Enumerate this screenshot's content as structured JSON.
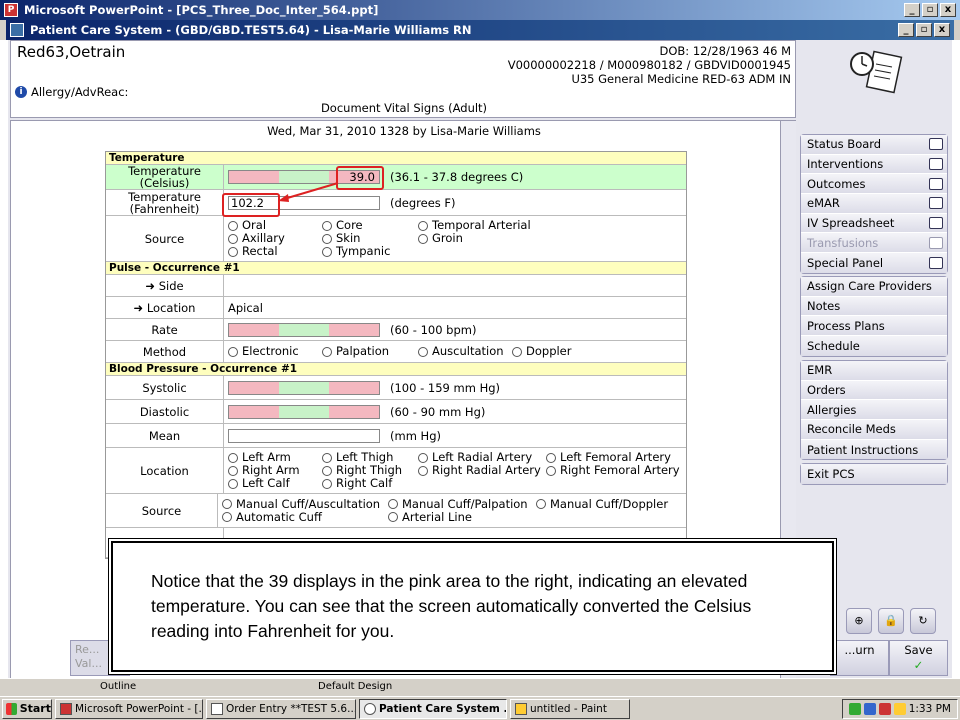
{
  "ppt_window": {
    "title": "Microsoft PowerPoint - [PCS_Three_Doc_Inter_564.ppt]"
  },
  "pcs_window": {
    "title": "Patient Care System - (GBD/GBD.TEST5.64) - Lisa-Marie Williams RN"
  },
  "window_buttons": {
    "minimize": "_",
    "restore": "▫",
    "close": "x"
  },
  "patient": {
    "name": "Red63,Oetrain",
    "dob": "DOB: 12/28/1963 46 M",
    "ids": "V00000002218 / M000980182 / GBDVID0001945",
    "location": "U35 General Medicine  RED-63  ADM IN",
    "allergy_label": "Allergy/AdvReac:",
    "info_glyph": "i"
  },
  "document": {
    "title": "Document Vital Signs (Adult)",
    "date_line": "Wed,  Mar 31, 2010 1328  by  Lisa-Marie Williams"
  },
  "form": {
    "temperature_header": "Temperature",
    "temp_c_label_1": "Temperature",
    "temp_c_label_2": "(Celsius)",
    "temp_c_value": "39.0",
    "temp_c_range": "(36.1 - 37.8 degrees C)",
    "temp_f_label_1": "Temperature",
    "temp_f_label_2": "(Fahrenheit)",
    "temp_f_value": "102.2",
    "temp_f_unit": "(degrees F)",
    "source_label": "Source",
    "temp_sources": [
      "Oral",
      "Core",
      "Temporal Arterial",
      "Axillary",
      "Skin",
      "Groin",
      "Rectal",
      "Tympanic"
    ],
    "pulse_header": "Pulse - Occurrence #1",
    "side_label": "Side",
    "location_label": "Location",
    "pulse_location_value": "Apical",
    "rate_label": "Rate",
    "rate_range": "(60 - 100 bpm)",
    "method_label": "Method",
    "pulse_methods": [
      "Electronic",
      "Palpation",
      "Auscultation",
      "Doppler"
    ],
    "bp_header": "Blood Pressure - Occurrence #1",
    "systolic_label": "Systolic",
    "systolic_range": "(100 - 159 mm Hg)",
    "diastolic_label": "Diastolic",
    "diastolic_range": "(60 - 90 mm Hg)",
    "mean_label": "Mean",
    "mean_unit": "(mm Hg)",
    "bp_location_label": "Location",
    "bp_locations": [
      "Left Arm",
      "Left Thigh",
      "Left Radial Artery",
      "Left Femoral Artery",
      "Right Arm",
      "Right Thigh",
      "Right Radial Artery",
      "Right Femoral Artery",
      "Left Calf",
      "Right Calf"
    ],
    "bp_source_label": "Source",
    "bp_sources_row1": [
      "Manual Cuff/Auscultation",
      "Manual Cuff/Palpation",
      "Manual Cuff/Doppler"
    ],
    "bp_sources_row2": [
      "Automatic Cuff",
      "Arterial Line"
    ],
    "arrow": "➜"
  },
  "sidebar": {
    "group1": [
      "Status Board",
      "Interventions",
      "Outcomes",
      "eMAR",
      "IV Spreadsheet",
      "Transfusions",
      "Special Panel"
    ],
    "group2": [
      "Assign Care Providers",
      "Notes",
      "Process Plans",
      "Schedule"
    ],
    "group3": [
      "EMR",
      "Orders",
      "Allergies",
      "Reconcile Meds",
      "Patient Instructions"
    ],
    "group4": [
      "Exit PCS"
    ]
  },
  "bottom": {
    "left_button": "Re...\nVal...",
    "return_label": "...urn",
    "save_label": "Save",
    "save_glyph": "✓"
  },
  "callout": {
    "text": "Notice that the 39 displays in the pink area to the right, indicating an elevated temperature. You can see that the screen automatically converted the Celsius reading into Fahrenheit for you."
  },
  "statusbar": {
    "outline": "Outline",
    "design": "Default Design"
  },
  "taskbar": {
    "start": "Start",
    "items": [
      "Microsoft PowerPoint - [...",
      "Order Entry **TEST 5.6...",
      "Patient Care System ...",
      "untitled - Paint"
    ],
    "time": "1:33 PM"
  },
  "colors": {
    "normal_green": "#c8f2c8",
    "abnormal_pink": "#f4b8c0",
    "highlight_red": "#d22222"
  }
}
